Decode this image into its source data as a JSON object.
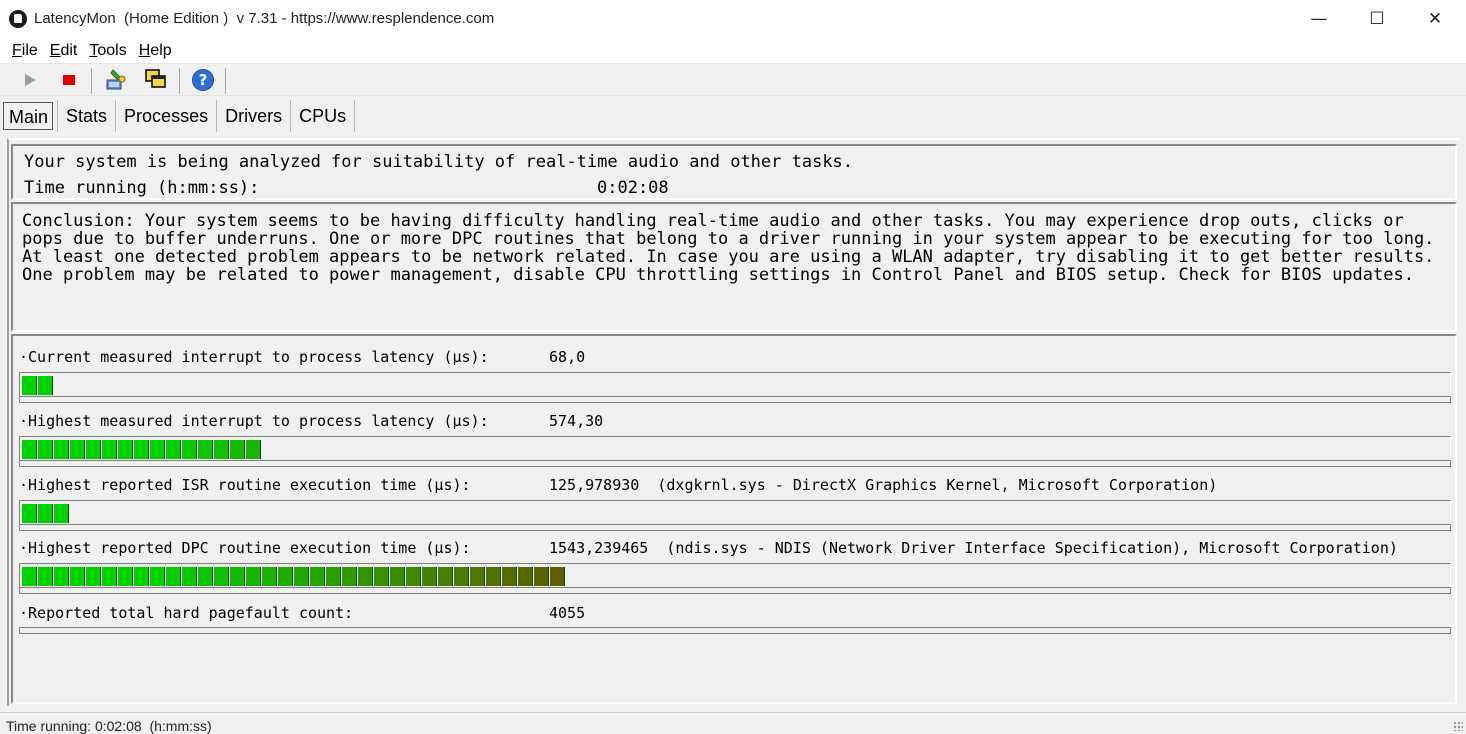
{
  "window": {
    "title": "LatencyMon  (Home Edition )  v 7.31 - https://www.resplendence.com",
    "minimize_glyph": "—",
    "maximize_glyph": "☐",
    "close_glyph": "✕"
  },
  "menu": {
    "items": [
      {
        "accel": "F",
        "rest": "ile"
      },
      {
        "accel": "E",
        "rest": "dit"
      },
      {
        "accel": "T",
        "rest": "ools"
      },
      {
        "accel": "H",
        "rest": "elp"
      }
    ]
  },
  "toolbar": {
    "icons": [
      "play-icon",
      "stop-icon",
      "driver-settings-icon",
      "windows-icon",
      "help-icon"
    ],
    "help_glyph": "?"
  },
  "tabs": [
    {
      "label": "Main",
      "active": true
    },
    {
      "label": "Stats",
      "active": false
    },
    {
      "label": "Processes",
      "active": false
    },
    {
      "label": "Drivers",
      "active": false
    },
    {
      "label": "CPUs",
      "active": false
    }
  ],
  "summary": {
    "status_line": "Your system is being analyzed for suitability of real-time audio and other tasks.",
    "time_label": "Time running (h:mm:ss):",
    "time_value": "0:02:08"
  },
  "conclusion": "Conclusion: Your system seems to be having difficulty handling real-time audio and other tasks. You may experience drop outs, clicks or pops due to buffer underruns. One or more DPC routines that belong to a driver running in your system appear to be executing for too long. At least one detected problem appears to be network related. In case you are using a WLAN adapter, try disabling it to get better results. One problem may be related to power management, disable CPU throttling settings in Control Panel and BIOS setup. Check for BIOS updates.",
  "metrics": [
    {
      "label": "·Current measured interrupt to process latency (µs):",
      "value": "68,0",
      "segments": 2
    },
    {
      "label": "·Highest measured interrupt to process latency (µs):",
      "value": "574,30",
      "segments": 15
    },
    {
      "label": "·Highest reported ISR routine execution time (µs):",
      "value": "125,978930  (dxgkrnl.sys - DirectX Graphics Kernel, Microsoft Corporation)",
      "segments": 3
    },
    {
      "label": "·Highest reported DPC routine execution time (µs):",
      "value": "1543,239465  (ndis.sys - NDIS (Network Driver Interface Specification), Microsoft Corporation)",
      "segments": 34
    },
    {
      "label": "·Reported total hard pagefault count:",
      "value": "4055",
      "segments": 0
    }
  ],
  "status_bar": "Time running: 0:02:08  (h:mm:ss)"
}
